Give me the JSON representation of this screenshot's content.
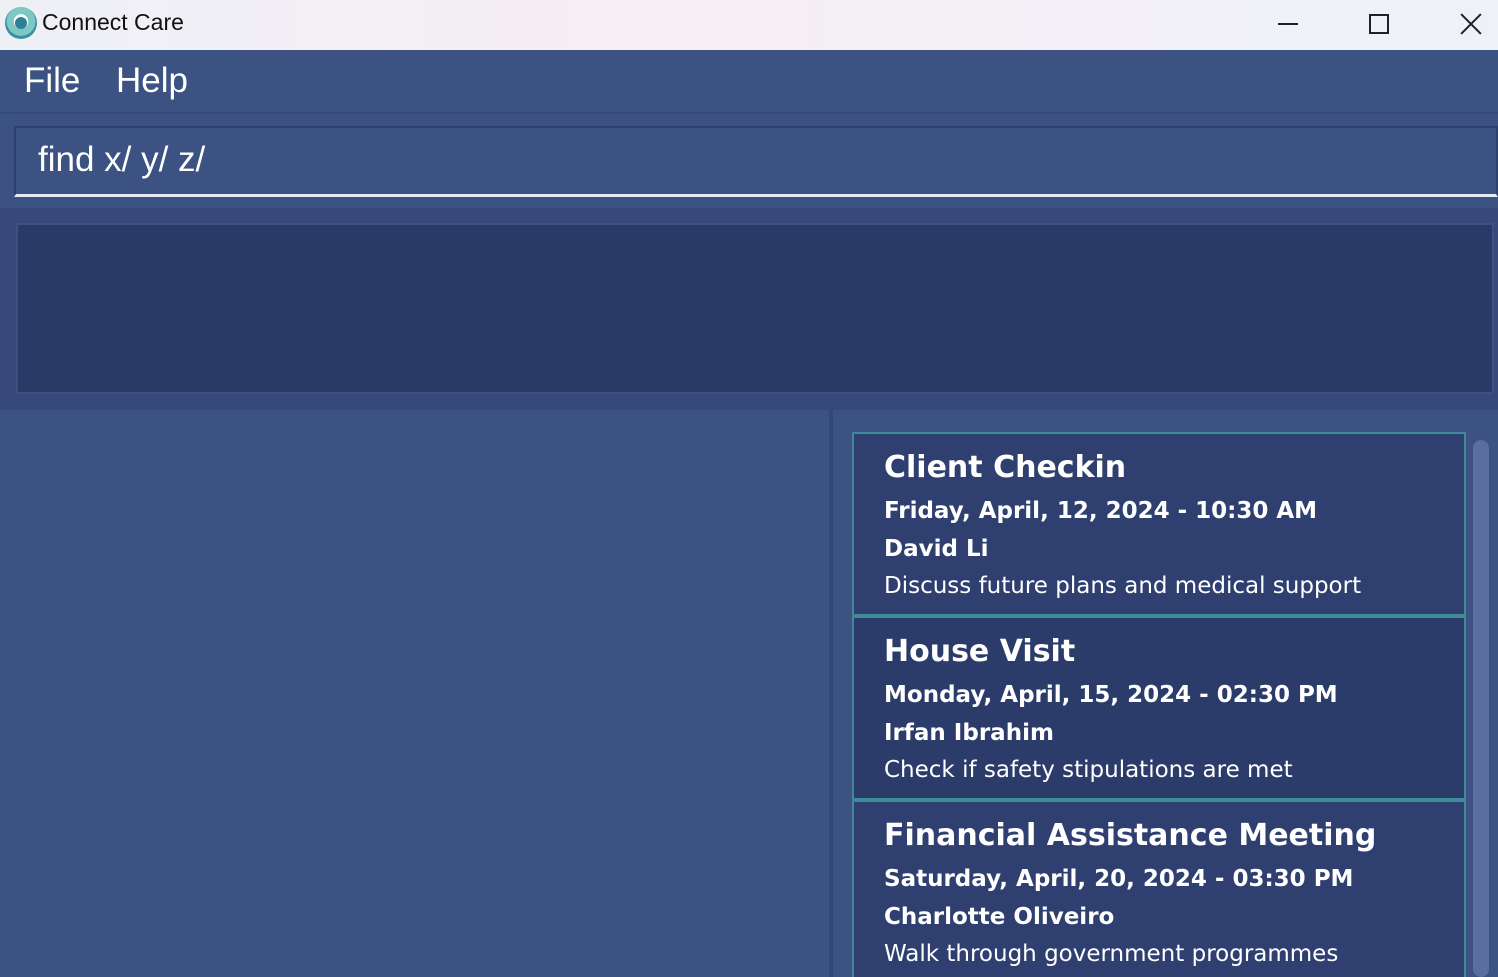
{
  "window": {
    "title": "Connect Care"
  },
  "menu": {
    "items": [
      {
        "label": "File"
      },
      {
        "label": "Help"
      }
    ]
  },
  "command": {
    "value": "find x/ y/ z/"
  },
  "result": {
    "text": ""
  },
  "appointments": [
    {
      "title": "Client Checkin",
      "datetime": "Friday, April, 12, 2024 - 10:30 AM",
      "client": "David Li",
      "notes": "Discuss future plans and medical support"
    },
    {
      "title": "House Visit",
      "datetime": "Monday, April, 15, 2024 - 02:30 PM",
      "client": "Irfan Ibrahim",
      "notes": "Check if safety stipulations are met"
    },
    {
      "title": "Financial Assistance Meeting",
      "datetime": "Saturday, April, 20, 2024 - 03:30 PM",
      "client": "Charlotte Oliveiro",
      "notes": "Walk through government programmes"
    }
  ],
  "colors": {
    "background": "#3c5283",
    "result_box": "#2a3a66",
    "card_border": "#3f8a96",
    "text": "#ffffff"
  }
}
